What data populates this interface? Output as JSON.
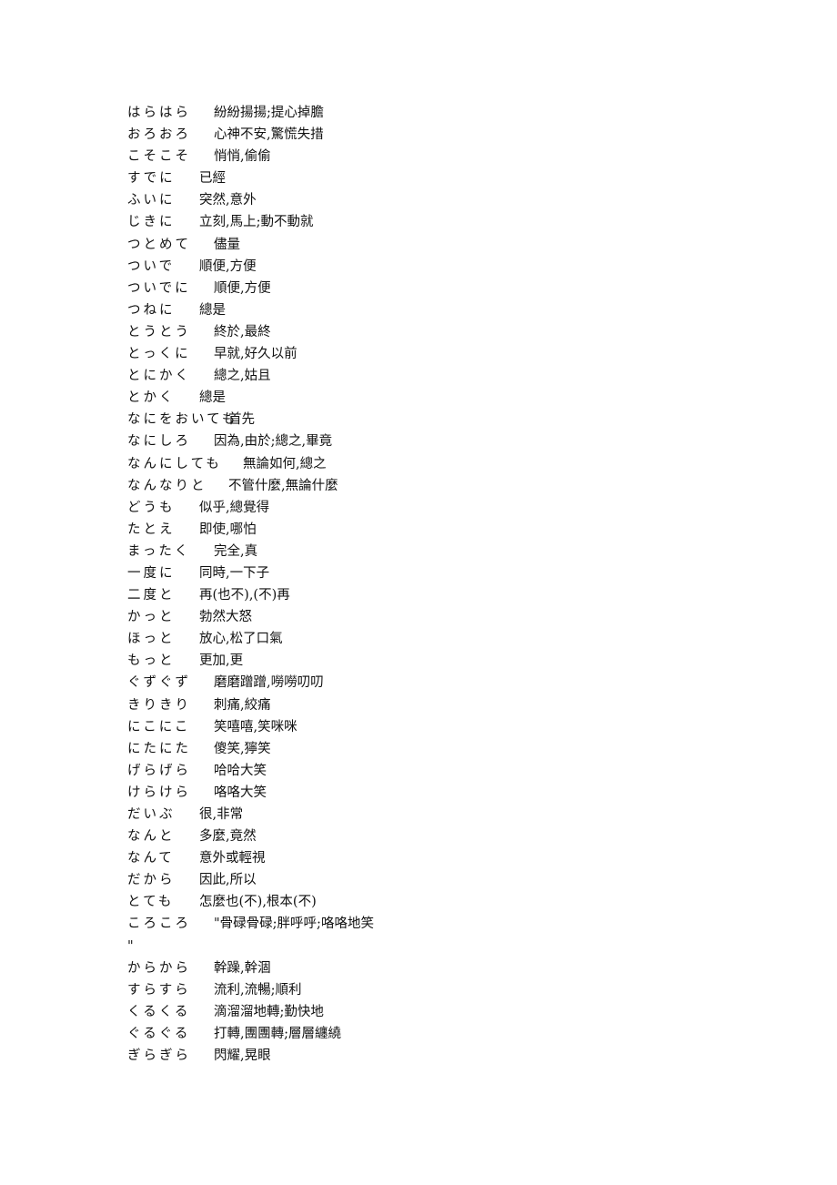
{
  "entries": [
    {
      "term": "はらはら",
      "definition": "紛紛揚揚;提心掉膽",
      "tab": 2
    },
    {
      "term": "おろおろ",
      "definition": "心神不安,驚慌失措",
      "tab": 2
    },
    {
      "term": "こそこそ",
      "definition": "悄悄,偷偷",
      "tab": 2
    },
    {
      "term": "すでに",
      "definition": "已經",
      "tab": 1
    },
    {
      "term": "ふいに",
      "definition": "突然,意外",
      "tab": 1
    },
    {
      "term": "じきに",
      "definition": "立刻,馬上;動不動就",
      "tab": 1
    },
    {
      "term": "つとめて",
      "definition": "儘量",
      "tab": 2
    },
    {
      "term": "ついで",
      "definition": "順便,方便",
      "tab": 1
    },
    {
      "term": "ついでに",
      "definition": "順便,方便",
      "tab": 2
    },
    {
      "term": "つねに",
      "definition": "總是",
      "tab": 1
    },
    {
      "term": "とうとう",
      "definition": "終於,最終",
      "tab": 2
    },
    {
      "term": "とっくに",
      "definition": "早就,好久以前",
      "tab": 2
    },
    {
      "term": "とにかく",
      "definition": "總之,姑且",
      "tab": 2
    },
    {
      "term": "とかく",
      "definition": "總是",
      "tab": 1
    },
    {
      "term": "なにをおいても",
      "definition": "首先",
      "tab": 5
    },
    {
      "term": "なにしろ",
      "definition": "因為,由於;總之,畢竟",
      "tab": 2
    },
    {
      "term": "なんにしても",
      "definition": "無論如何,總之",
      "tab": 4
    },
    {
      "term": "なんなりと",
      "definition": "不管什麼,無論什麼",
      "tab": 3
    },
    {
      "term": "どうも",
      "definition": "似乎,總覺得",
      "tab": 1
    },
    {
      "term": "たとえ",
      "definition": "即使,哪怕",
      "tab": 1
    },
    {
      "term": "まったく",
      "definition": "完全,真",
      "tab": 2
    },
    {
      "term": "一度に",
      "definition": "同時,一下子",
      "tab": 1
    },
    {
      "term": "二度と",
      "definition": "再(也不),(不)再",
      "tab": 1
    },
    {
      "term": "かっと",
      "definition": "勃然大怒",
      "tab": 1
    },
    {
      "term": "ほっと",
      "definition": "放心,松了口氣",
      "tab": 1
    },
    {
      "term": "もっと",
      "definition": "更加,更",
      "tab": 1
    },
    {
      "term": "ぐずぐず",
      "definition": "磨磨蹭蹭,嘮嘮叨叨",
      "tab": 2
    },
    {
      "term": "きりきり",
      "definition": "刺痛,絞痛",
      "tab": 2
    },
    {
      "term": "にこにこ",
      "definition": "笑嘻嘻,笑咪咪",
      "tab": 2
    },
    {
      "term": "にたにた",
      "definition": "傻笑,獰笑",
      "tab": 2
    },
    {
      "term": "げらげら",
      "definition": "哈哈大笑",
      "tab": 2
    },
    {
      "term": "けらけら",
      "definition": "咯咯大笑",
      "tab": 2
    },
    {
      "term": "だいぶ",
      "definition": "很,非常",
      "tab": 1
    },
    {
      "term": "なんと",
      "definition": "多麼,竟然",
      "tab": 1
    },
    {
      "term": "なんて",
      "definition": "意外或輕視",
      "tab": 1
    },
    {
      "term": "だから",
      "definition": "因此,所以",
      "tab": 1
    },
    {
      "term": "とても",
      "definition": "怎麼也(不),根本(不)",
      "tab": 1
    },
    {
      "term": "ころころ",
      "definition": "\"骨碌骨碌;胖呼呼;咯咯地笑",
      "tab": 2,
      "continuation": "\""
    },
    {
      "term": "からから",
      "definition": "幹躁,幹涸",
      "tab": 2
    },
    {
      "term": "すらすら",
      "definition": "流利,流暢;順利",
      "tab": 2
    },
    {
      "term": "くるくる",
      "definition": "滴溜溜地轉;勤快地",
      "tab": 2
    },
    {
      "term": "ぐるぐる",
      "definition": "打轉,團團轉;層層纏繞",
      "tab": 2
    },
    {
      "term": "ぎらぎら",
      "definition": "閃耀,晃眼",
      "tab": 2
    }
  ]
}
